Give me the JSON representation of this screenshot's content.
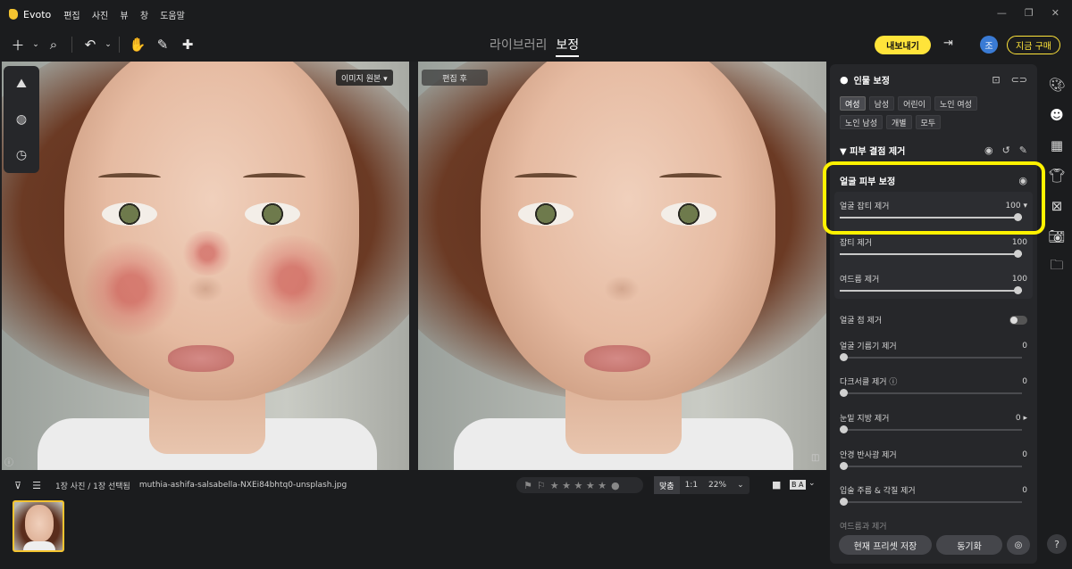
{
  "app": {
    "name": "Evoto",
    "menu": [
      "편집",
      "사진",
      "뷰",
      "창",
      "도움말"
    ]
  },
  "mode_tabs": {
    "library": "라이브러리",
    "edit": "보정"
  },
  "header": {
    "export_label": "내보내기",
    "avatar_initial": "조",
    "buy_label": "지금 구매"
  },
  "viewer": {
    "original_label": "이미지 원본 ▾",
    "after_label": "편집 후"
  },
  "filmstrip": {
    "count_text": "1장 사진 / 1장 선택됨",
    "filename": "muthia-ashifa-salsabella-NXEi84bhtq0-unsplash.jpg",
    "stars": "★ ★ ★ ★ ★",
    "zoom_fit": "맞춤",
    "zoom_1to1": "1:1",
    "zoom_pct": "22%",
    "compare_label": "B A"
  },
  "panel": {
    "title": "인물 보정",
    "chips_row1": [
      "여성",
      "남성",
      "어린이",
      "노인 여성"
    ],
    "chips_row2": [
      "노인 남성",
      "개별",
      "모두"
    ],
    "section_title": "▼  피부 결점 제거",
    "sub_title": "얼굴 피부 보정",
    "sliders": [
      {
        "label": "얼굴 잡티 제거",
        "value": "100 ▾",
        "level": 1.0
      },
      {
        "label": "잡티 제거",
        "value": "100",
        "level": 1.0
      },
      {
        "label": "여드름 제거",
        "value": "100",
        "level": 1.0
      }
    ],
    "toggle_label": "얼굴 점 제거",
    "sliders2": [
      {
        "label": "얼굴 기름기 제거",
        "value": "0",
        "level": 0
      },
      {
        "label": "다크서클 제거 ⓘ",
        "value": "0",
        "level": 0
      },
      {
        "label": "눈밑 지방 제거",
        "value": "0 ▸",
        "level": 0
      },
      {
        "label": "안경 반사광 제거",
        "value": "0",
        "level": 0
      },
      {
        "label": "입술 주름 & 각질 제거",
        "value": "0",
        "level": 0
      }
    ],
    "cut_label": "여드름과 제거",
    "save_preset_label": "현재 프리셋 저장",
    "sync_label": "동기화"
  },
  "colors": {
    "accent": "#ffe43a",
    "highlight": "#fff200",
    "panel": "#26272a"
  }
}
